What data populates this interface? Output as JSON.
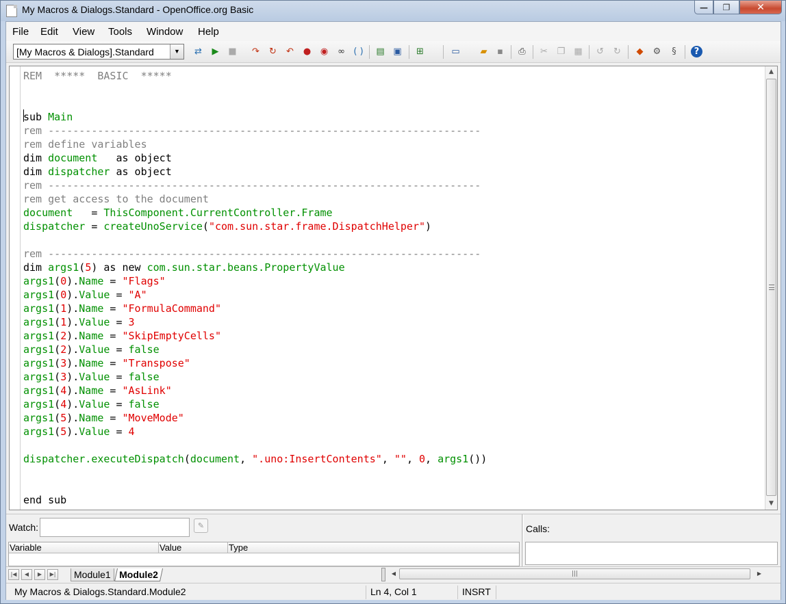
{
  "window": {
    "title": "My Macros & Dialogs.Standard - OpenOffice.org Basic",
    "minimize_glyph": "—",
    "maximize_glyph": "❐",
    "close_glyph": "✕"
  },
  "menu": [
    {
      "label": "File"
    },
    {
      "label": "Edit"
    },
    {
      "label": "View"
    },
    {
      "label": "Tools"
    },
    {
      "label": "Window"
    },
    {
      "label": "Help"
    }
  ],
  "toolbar": {
    "library_combo": "[My Macros & Dialogs].Standard",
    "icons": [
      "compile-icon",
      "run-icon",
      "stop-icon",
      "step-into-icon",
      "step-over-icon",
      "step-out-icon",
      "breakpoint-icon",
      "breakpoint-manage-icon",
      "watch-icon",
      "find-parentheses-icon",
      "macros-icon",
      "modules-icon",
      "insert-source-icon",
      "new-document-icon",
      "open-icon",
      "save-icon",
      "print-icon",
      "cut-icon",
      "copy-icon",
      "paste-icon",
      "undo-icon",
      "redo-icon",
      "insert-controls-icon",
      "settings-icon",
      "tools-icon",
      "help-icon"
    ]
  },
  "editor": {
    "lines": [
      {
        "spans": [
          {
            "t": "REM  *****  BASIC  *****",
            "c": "cm"
          }
        ]
      },
      {
        "spans": []
      },
      {
        "spans": []
      },
      {
        "spans": [
          {
            "t": "sub ",
            "c": "kw"
          },
          {
            "t": "Main",
            "c": "id"
          }
        ]
      },
      {
        "spans": [
          {
            "t": "rem ----------------------------------------------------------------------",
            "c": "cm"
          }
        ]
      },
      {
        "spans": [
          {
            "t": "rem define variables",
            "c": "cm"
          }
        ]
      },
      {
        "spans": [
          {
            "t": "dim ",
            "c": "kw"
          },
          {
            "t": "document",
            "c": "id"
          },
          {
            "t": "   as object",
            "c": "kw"
          }
        ]
      },
      {
        "spans": [
          {
            "t": "dim ",
            "c": "kw"
          },
          {
            "t": "dispatcher",
            "c": "id"
          },
          {
            "t": " as object",
            "c": "kw"
          }
        ]
      },
      {
        "spans": [
          {
            "t": "rem ----------------------------------------------------------------------",
            "c": "cm"
          }
        ]
      },
      {
        "spans": [
          {
            "t": "rem get access to the document",
            "c": "cm"
          }
        ]
      },
      {
        "spans": [
          {
            "t": "document",
            "c": "id"
          },
          {
            "t": "   = ",
            "c": "op"
          },
          {
            "t": "ThisComponent.CurrentController.Frame",
            "c": "id"
          }
        ]
      },
      {
        "spans": [
          {
            "t": "dispatcher",
            "c": "id"
          },
          {
            "t": " = ",
            "c": "op"
          },
          {
            "t": "createUnoService",
            "c": "id"
          },
          {
            "t": "(",
            "c": "op"
          },
          {
            "t": "\"com.sun.star.frame.DispatchHelper\"",
            "c": "st"
          },
          {
            "t": ")",
            "c": "op"
          }
        ]
      },
      {
        "spans": []
      },
      {
        "spans": [
          {
            "t": "rem ----------------------------------------------------------------------",
            "c": "cm"
          }
        ]
      },
      {
        "spans": [
          {
            "t": "dim ",
            "c": "kw"
          },
          {
            "t": "args1",
            "c": "id"
          },
          {
            "t": "(",
            "c": "op"
          },
          {
            "t": "5",
            "c": "nm"
          },
          {
            "t": ") as new ",
            "c": "kw"
          },
          {
            "t": "com.sun.star.beans.PropertyValue",
            "c": "id"
          }
        ]
      },
      {
        "spans": [
          {
            "t": "args1",
            "c": "id"
          },
          {
            "t": "(",
            "c": "op"
          },
          {
            "t": "0",
            "c": "nm"
          },
          {
            "t": ").",
            "c": "op"
          },
          {
            "t": "Name",
            "c": "id"
          },
          {
            "t": " = ",
            "c": "op"
          },
          {
            "t": "\"Flags\"",
            "c": "st"
          }
        ]
      },
      {
        "spans": [
          {
            "t": "args1",
            "c": "id"
          },
          {
            "t": "(",
            "c": "op"
          },
          {
            "t": "0",
            "c": "nm"
          },
          {
            "t": ").",
            "c": "op"
          },
          {
            "t": "Value",
            "c": "id"
          },
          {
            "t": " = ",
            "c": "op"
          },
          {
            "t": "\"A\"",
            "c": "st"
          }
        ]
      },
      {
        "spans": [
          {
            "t": "args1",
            "c": "id"
          },
          {
            "t": "(",
            "c": "op"
          },
          {
            "t": "1",
            "c": "nm"
          },
          {
            "t": ").",
            "c": "op"
          },
          {
            "t": "Name",
            "c": "id"
          },
          {
            "t": " = ",
            "c": "op"
          },
          {
            "t": "\"FormulaCommand\"",
            "c": "st"
          }
        ]
      },
      {
        "spans": [
          {
            "t": "args1",
            "c": "id"
          },
          {
            "t": "(",
            "c": "op"
          },
          {
            "t": "1",
            "c": "nm"
          },
          {
            "t": ").",
            "c": "op"
          },
          {
            "t": "Value",
            "c": "id"
          },
          {
            "t": " = ",
            "c": "op"
          },
          {
            "t": "3",
            "c": "nm"
          }
        ]
      },
      {
        "spans": [
          {
            "t": "args1",
            "c": "id"
          },
          {
            "t": "(",
            "c": "op"
          },
          {
            "t": "2",
            "c": "nm"
          },
          {
            "t": ").",
            "c": "op"
          },
          {
            "t": "Name",
            "c": "id"
          },
          {
            "t": " = ",
            "c": "op"
          },
          {
            "t": "\"SkipEmptyCells\"",
            "c": "st"
          }
        ]
      },
      {
        "spans": [
          {
            "t": "args1",
            "c": "id"
          },
          {
            "t": "(",
            "c": "op"
          },
          {
            "t": "2",
            "c": "nm"
          },
          {
            "t": ").",
            "c": "op"
          },
          {
            "t": "Value",
            "c": "id"
          },
          {
            "t": " = ",
            "c": "op"
          },
          {
            "t": "false",
            "c": "id"
          }
        ]
      },
      {
        "spans": [
          {
            "t": "args1",
            "c": "id"
          },
          {
            "t": "(",
            "c": "op"
          },
          {
            "t": "3",
            "c": "nm"
          },
          {
            "t": ").",
            "c": "op"
          },
          {
            "t": "Name",
            "c": "id"
          },
          {
            "t": " = ",
            "c": "op"
          },
          {
            "t": "\"Transpose\"",
            "c": "st"
          }
        ]
      },
      {
        "spans": [
          {
            "t": "args1",
            "c": "id"
          },
          {
            "t": "(",
            "c": "op"
          },
          {
            "t": "3",
            "c": "nm"
          },
          {
            "t": ").",
            "c": "op"
          },
          {
            "t": "Value",
            "c": "id"
          },
          {
            "t": " = ",
            "c": "op"
          },
          {
            "t": "false",
            "c": "id"
          }
        ]
      },
      {
        "spans": [
          {
            "t": "args1",
            "c": "id"
          },
          {
            "t": "(",
            "c": "op"
          },
          {
            "t": "4",
            "c": "nm"
          },
          {
            "t": ").",
            "c": "op"
          },
          {
            "t": "Name",
            "c": "id"
          },
          {
            "t": " = ",
            "c": "op"
          },
          {
            "t": "\"AsLink\"",
            "c": "st"
          }
        ]
      },
      {
        "spans": [
          {
            "t": "args1",
            "c": "id"
          },
          {
            "t": "(",
            "c": "op"
          },
          {
            "t": "4",
            "c": "nm"
          },
          {
            "t": ").",
            "c": "op"
          },
          {
            "t": "Value",
            "c": "id"
          },
          {
            "t": " = ",
            "c": "op"
          },
          {
            "t": "false",
            "c": "id"
          }
        ]
      },
      {
        "spans": [
          {
            "t": "args1",
            "c": "id"
          },
          {
            "t": "(",
            "c": "op"
          },
          {
            "t": "5",
            "c": "nm"
          },
          {
            "t": ").",
            "c": "op"
          },
          {
            "t": "Name",
            "c": "id"
          },
          {
            "t": " = ",
            "c": "op"
          },
          {
            "t": "\"MoveMode\"",
            "c": "st"
          }
        ]
      },
      {
        "spans": [
          {
            "t": "args1",
            "c": "id"
          },
          {
            "t": "(",
            "c": "op"
          },
          {
            "t": "5",
            "c": "nm"
          },
          {
            "t": ").",
            "c": "op"
          },
          {
            "t": "Value",
            "c": "id"
          },
          {
            "t": " = ",
            "c": "op"
          },
          {
            "t": "4",
            "c": "nm"
          }
        ]
      },
      {
        "spans": []
      },
      {
        "spans": [
          {
            "t": "dispatcher.executeDispatch",
            "c": "id"
          },
          {
            "t": "(",
            "c": "op"
          },
          {
            "t": "document",
            "c": "id"
          },
          {
            "t": ", ",
            "c": "op"
          },
          {
            "t": "\".uno:InsertContents\"",
            "c": "st"
          },
          {
            "t": ", ",
            "c": "op"
          },
          {
            "t": "\"\"",
            "c": "st"
          },
          {
            "t": ", ",
            "c": "op"
          },
          {
            "t": "0",
            "c": "nm"
          },
          {
            "t": ", ",
            "c": "op"
          },
          {
            "t": "args1",
            "c": "id"
          },
          {
            "t": "())",
            "c": "op"
          }
        ]
      },
      {
        "spans": []
      },
      {
        "spans": []
      },
      {
        "spans": [
          {
            "t": "end sub",
            "c": "kw"
          }
        ]
      }
    ]
  },
  "watch": {
    "label": "Watch:",
    "input_value": "",
    "columns": [
      "Variable",
      "Value",
      "Type"
    ]
  },
  "calls": {
    "label": "Calls:"
  },
  "tabs": [
    {
      "label": "Module1",
      "active": false
    },
    {
      "label": "Module2",
      "active": true
    }
  ],
  "status": {
    "location": "My Macros & Dialogs.Standard.Module2",
    "position": "Ln 4, Col 1",
    "mode": "INSRT"
  },
  "colors": {
    "identifier": "#009000",
    "comment": "#808080",
    "string": "#e00000",
    "keyword": "#000000"
  }
}
